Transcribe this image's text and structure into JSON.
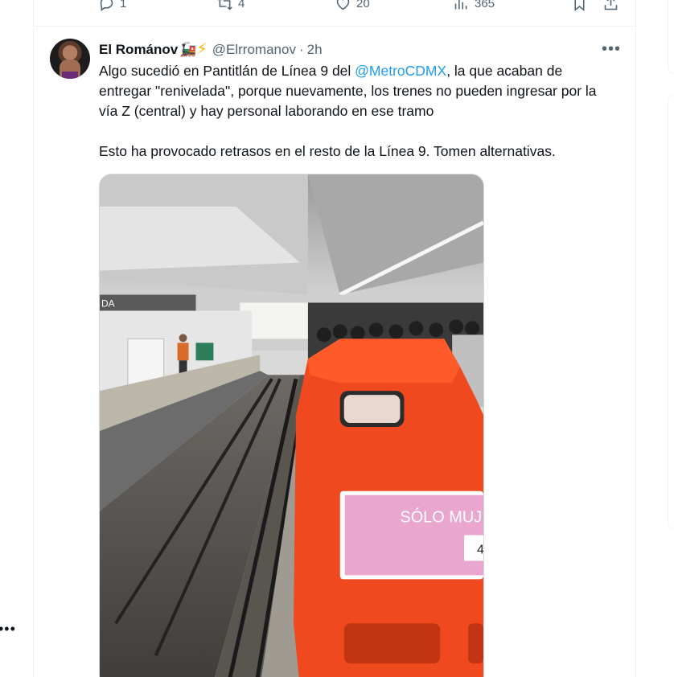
{
  "previous_tweet_actions": {
    "reply_count": "1",
    "retweet_count": "4",
    "like_count": "20",
    "views_count": "365"
  },
  "tweet": {
    "author_name": "El Románov",
    "author_emoji_train": "🚂",
    "author_emoji_bolt": "⚡",
    "handle": "@Elrromanov",
    "separator": "·",
    "time": "2h",
    "more_label": "•••",
    "text_line_start": "Algo sucedió en Pantitlán de Línea 9 del ",
    "mention": "@MetroCDMX",
    "text_line_end": ", la que acaban de entregar \"renivelada\", porque nuevamente, los trenes no pueden ingresar por la vía Z (central) y hay personal laborando en ese tramo",
    "text_paragraph_2": "Esto ha provocado retrasos en el resto de la Línea 9. Tomen alternativas.",
    "photo_sign_text": "SÓLO MUJ",
    "photo_sign_number": "4",
    "photo_platform_text": "DA"
  },
  "sidebar_more_label": "•••"
}
